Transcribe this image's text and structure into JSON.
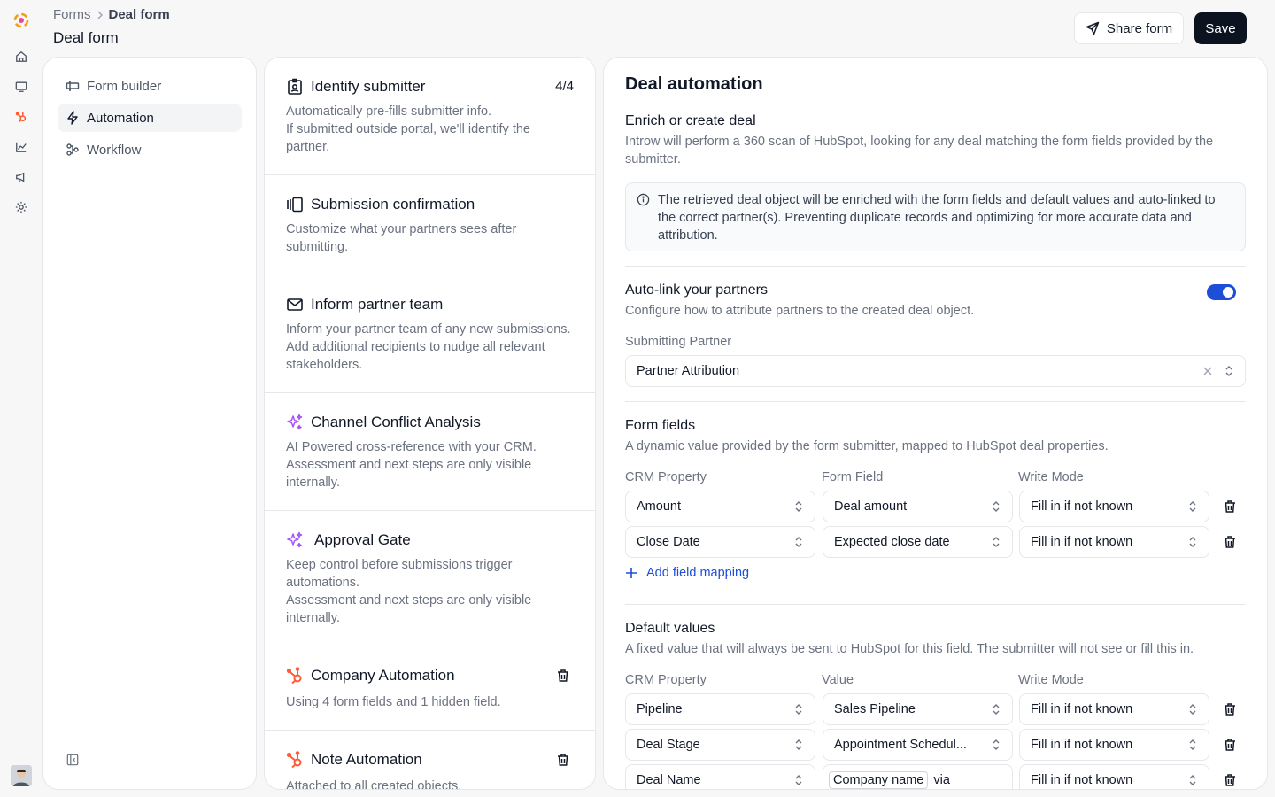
{
  "breadcrumb": {
    "parent": "Forms",
    "current": "Deal form"
  },
  "page_title": "Deal form",
  "header": {
    "share_label": "Share form",
    "save_label": "Save"
  },
  "nav": {
    "items": [
      {
        "label": "Form builder",
        "icon": "form-builder-icon"
      },
      {
        "label": "Automation",
        "icon": "lightning-icon",
        "active": true
      },
      {
        "label": "Workflow",
        "icon": "workflow-icon"
      }
    ]
  },
  "steps": [
    {
      "title": "Identify submitter",
      "count": "4/4",
      "desc": [
        "Automatically pre-fills submitter info.",
        "If submitted outside portal, we'll identify the partner."
      ],
      "icon": "id-badge-icon"
    },
    {
      "title": "Submission confirmation",
      "desc": [
        "Customize what your partners sees after submitting."
      ],
      "icon": "slides-icon"
    },
    {
      "title": "Inform partner team",
      "desc": [
        "Inform your partner team of any new submissions.",
        "Add additional recipients to nudge all relevant stakeholders."
      ],
      "icon": "mail-icon"
    },
    {
      "title": "Channel Conflict Analysis",
      "desc": [
        "AI Powered cross-reference with your CRM.",
        "Assessment and next steps are only visible internally."
      ],
      "icon": "sparkle-icon"
    },
    {
      "title": "Approval Gate",
      "desc": [
        "Keep control before submissions trigger automations.",
        "Assessment and next steps are only visible internally."
      ],
      "icon": "sparkle-icon"
    },
    {
      "title": "Company Automation",
      "desc": [
        "Using 4 form fields and 1 hidden field."
      ],
      "icon": "hubspot-icon"
    },
    {
      "title": "Note Automation",
      "desc": [
        "Attached to all created objects."
      ],
      "icon": "hubspot-icon"
    }
  ],
  "automation": {
    "title": "Deal automation",
    "enrich": {
      "title": "Enrich or create deal",
      "desc": "Introw will perform a 360 scan of HubSpot, looking for any deal matching the form fields provided by the submitter.",
      "info": "The retrieved deal object will be enriched with the form fields and default values and auto-linked to the correct partner(s). Preventing duplicate records and optimizing for more accurate data and attribution."
    },
    "autolink": {
      "title": "Auto-link your partners",
      "desc": "Configure how to attribute partners to the created deal object.",
      "enabled": true,
      "submitting_label": "Submitting Partner",
      "submitting_value": "Partner Attribution"
    },
    "form_fields": {
      "title": "Form fields",
      "desc": "A dynamic value provided by the form submitter, mapped to HubSpot deal properties.",
      "col1": "CRM Property",
      "col2": "Form Field",
      "col3": "Write Mode",
      "rows": [
        {
          "prop": "Amount",
          "field": "Deal amount",
          "mode": "Fill in if not known"
        },
        {
          "prop": "Close Date",
          "field": "Expected close date",
          "mode": "Fill in if not known"
        }
      ],
      "add_label": "Add field mapping"
    },
    "defaults": {
      "title": "Default values",
      "desc": "A fixed value that will always be sent to HubSpot for this field. The submitter will not see or fill this in.",
      "col1": "CRM Property",
      "col2": "Value",
      "col3": "Write Mode",
      "rows": [
        {
          "prop": "Pipeline",
          "value": "Sales Pipeline",
          "mode": "Fill in if not known"
        },
        {
          "prop": "Deal Stage",
          "value": "Appointment Schedul...",
          "mode": "Fill in if not known"
        },
        {
          "prop": "Deal Name",
          "value_chip": "Company name",
          "value_suffix": "via",
          "mode": "Fill in if not known"
        }
      ]
    }
  },
  "colors": {
    "accent": "#1d4ed8",
    "save_bg": "#0b1220",
    "hubspot": "#ff5c35",
    "ai": "#a855f7"
  }
}
